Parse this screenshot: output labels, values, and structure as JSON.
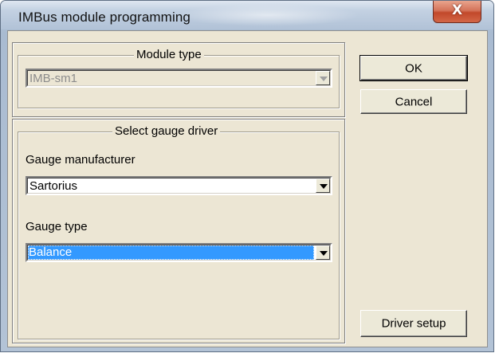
{
  "window": {
    "title": "IMBus module programming",
    "close_label": "X"
  },
  "module_group": {
    "title": "Module type",
    "module_type": {
      "value": "IMB-sm1",
      "enabled": false
    }
  },
  "gauge_group": {
    "title": "Select gauge driver",
    "manufacturer_label": "Gauge manufacturer",
    "manufacturer": {
      "value": "Sartorius"
    },
    "type_label": "Gauge type",
    "type": {
      "value": "Balance",
      "focused": true
    }
  },
  "buttons": {
    "ok": "OK",
    "cancel": "Cancel",
    "driver_setup": "Driver setup"
  },
  "colors": {
    "dialog_face": "#ece6d4",
    "selection": "#3399ff",
    "close_button": "#c2482b"
  }
}
